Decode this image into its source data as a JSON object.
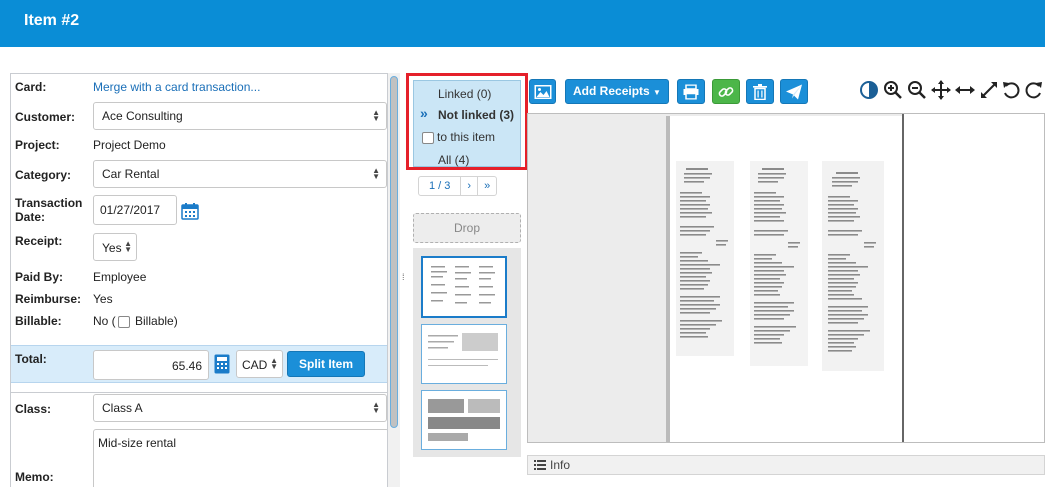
{
  "header": {
    "title": "Item #2"
  },
  "form": {
    "card": {
      "label": "Card:",
      "value": "Merge with a card transaction..."
    },
    "customer": {
      "label": "Customer:",
      "value": "Ace Consulting"
    },
    "project": {
      "label": "Project:",
      "value": "Project Demo"
    },
    "category": {
      "label": "Category:",
      "value": "Car Rental"
    },
    "transaction_date": {
      "label_line1": "Transaction",
      "label_line2": "Date:",
      "value": "01/27/2017"
    },
    "receipt": {
      "label": "Receipt:",
      "value": "Yes"
    },
    "paid_by": {
      "label": "Paid By:",
      "value": "Employee"
    },
    "reimburse": {
      "label": "Reimburse:",
      "value": "Yes"
    },
    "billable": {
      "label": "Billable:",
      "value_prefix": "No (",
      "checkbox_label": "Billable)"
    },
    "total": {
      "label": "Total:",
      "amount": "65.46",
      "currency": "CAD",
      "split_label": "Split Item"
    },
    "class": {
      "label": "Class:",
      "value": "Class A"
    },
    "memo": {
      "label": "Memo:",
      "value": "Mid-size rental"
    }
  },
  "filters": {
    "linked": "Linked (0)",
    "not_linked": "Not linked (3)",
    "to_this_item": "to this item",
    "all": "All (4)"
  },
  "pager": {
    "label": "1 / 3",
    "next": "›",
    "last": "»"
  },
  "drop": {
    "label": "Drop"
  },
  "toolbar": {
    "add_receipts": "Add Receipts"
  },
  "info": {
    "label": "Info"
  },
  "colors": {
    "brand_blue": "#0a8dd6",
    "button_blue": "#1b8fd8",
    "green": "#4cb649",
    "highlight_red": "#e5202a"
  },
  "icons": [
    "image-icon",
    "printer-icon",
    "link-icon",
    "trash-icon",
    "send-icon",
    "contrast-icon",
    "zoom-in-icon",
    "zoom-out-icon",
    "move-icon",
    "fit-width-icon",
    "fullscreen-icon",
    "rotate-left-icon",
    "rotate-right-icon",
    "calendar-icon",
    "calculator-icon",
    "list-icon"
  ]
}
